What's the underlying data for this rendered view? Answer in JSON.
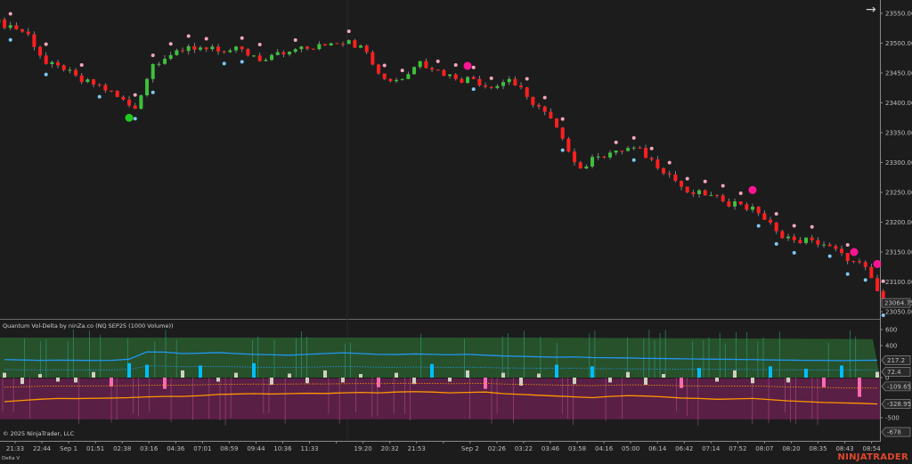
{
  "window": {
    "indicator_title": "Quantum Vol-Delta by ninZa.co (NQ SEP25 (1000 Volume))",
    "copyright": "© 2025 NinjaTrader, LLC",
    "panel_label": "Delta V",
    "brand": "NINJATRADER",
    "scroll_icon": "arrow-right-icon"
  },
  "colors": {
    "background": "#1c1c1c",
    "up": "#3cc13c",
    "down": "#ff1f1f",
    "resistance_dot": "#f4a7b9",
    "support_dot": "#7ec8f0",
    "signal_sell": "#ff1493",
    "signal_buy": "#22c822",
    "delta_band_pos": "#27512a",
    "delta_band_neg": "#5a1f45",
    "delta_line": "#2196f3",
    "neg_line": "#ff9800",
    "pos_bar": "#00bfff",
    "neg_bar": "#ff69b4",
    "neutral_bar": "#d0d0c0"
  },
  "chart_data": [
    {
      "type": "candlestick",
      "ylim": [
        23040,
        23565
      ],
      "y_ticks": [
        "23550.00",
        "23500.00",
        "23450.00",
        "23400.00",
        "23350.00",
        "23300.00",
        "23250.00",
        "23200.00",
        "23150.00",
        "23100.00",
        "23050.00"
      ],
      "y_tick_values": [
        23550,
        23500,
        23450,
        23400,
        23350,
        23300,
        23250,
        23200,
        23150,
        23100,
        23050
      ],
      "last_price_label": "23064.75",
      "last_price": 23064.75,
      "x_ticks": [
        "21:33",
        "22:44",
        "Sep 1",
        "01:51",
        "02:38",
        "03:16",
        "04:36",
        "07:01",
        "08:59",
        "09:44",
        "10:36",
        "11:33",
        "",
        "19:20",
        "20:32",
        "21:53",
        "",
        "Sep 2",
        "02:26",
        "03:22",
        "03:46",
        "03:58",
        "04:16",
        "05:00",
        "06:14",
        "06:42",
        "07:14",
        "07:52",
        "08:07",
        "08:20",
        "08:35",
        "08:43",
        "08:54"
      ],
      "closes": [
        23530,
        23515,
        23465,
        23455,
        23435,
        23430,
        23410,
        23390,
        23465,
        23480,
        23495,
        23490,
        23485,
        23490,
        23470,
        23485,
        23490,
        23490,
        23500,
        23505,
        23485,
        23440,
        23440,
        23470,
        23455,
        23440,
        23440,
        23425,
        23440,
        23410,
        23385,
        23340,
        23290,
        23310,
        23320,
        23325,
        23305,
        23280,
        23250,
        23245,
        23235,
        23230,
        23215,
        23185,
        23170,
        23170,
        23160,
        23135,
        23125,
        23064.75
      ],
      "signals": [
        {
          "index": 7,
          "price": 23375,
          "type": "buy"
        },
        {
          "index": 26,
          "price": 23462,
          "type": "sell"
        },
        {
          "index": 42,
          "price": 23254,
          "type": "sell"
        },
        {
          "index": 48,
          "price": 23150,
          "type": "sell"
        },
        {
          "index": 49,
          "price": 23130,
          "type": "sell"
        }
      ]
    },
    {
      "type": "histogram+line",
      "ylim": [
        -700,
        650
      ],
      "y_ticks": [
        "600",
        "400",
        "0",
        "-500"
      ],
      "y_tick_values": [
        600,
        400,
        0,
        -500
      ],
      "value_labels": [
        {
          "text": "217.2",
          "value": 217.2
        },
        {
          "text": "72.4",
          "value": 72.4
        },
        {
          "text": "-109.65",
          "value": -109.65
        },
        {
          "text": "-328.95",
          "value": -328.95
        },
        {
          "text": "-678",
          "value": -678
        }
      ],
      "band_upper": 500,
      "band_lower": -510,
      "delta_line": [
        225,
        220,
        215,
        218,
        216,
        214,
        215,
        230,
        320,
        318,
        300,
        305,
        312,
        300,
        290,
        285,
        280,
        290,
        300,
        310,
        300,
        290,
        288,
        295,
        290,
        285,
        290,
        280,
        270,
        265,
        260,
        255,
        258,
        250,
        248,
        245,
        240,
        238,
        235,
        232,
        230,
        228,
        225,
        220,
        218,
        215,
        215,
        212,
        215,
        217.2
      ],
      "neg_line": [
        -300,
        -285,
        -270,
        -260,
        -262,
        -258,
        -255,
        -250,
        -240,
        -235,
        -235,
        -225,
        -210,
        -205,
        -200,
        -205,
        -200,
        -195,
        -198,
        -190,
        -185,
        -190,
        -180,
        -175,
        -180,
        -190,
        -185,
        -180,
        -200,
        -210,
        -220,
        -230,
        -240,
        -250,
        -235,
        -225,
        -230,
        -240,
        -255,
        -260,
        -270,
        -265,
        -260,
        -275,
        -290,
        -300,
        -310,
        -315,
        -320,
        -328.95
      ],
      "delta_bars": [
        60,
        -80,
        40,
        -50,
        -60,
        70,
        -110,
        180,
        160,
        -140,
        90,
        150,
        -50,
        60,
        180,
        -90,
        50,
        -70,
        90,
        -60,
        40,
        -120,
        60,
        -80,
        170,
        -50,
        90,
        -140,
        60,
        -100,
        50,
        160,
        -80,
        140,
        -60,
        70,
        -90,
        40,
        -130,
        120,
        -50,
        90,
        -70,
        140,
        -60,
        110,
        -120,
        150,
        -240,
        72.4
      ]
    }
  ]
}
